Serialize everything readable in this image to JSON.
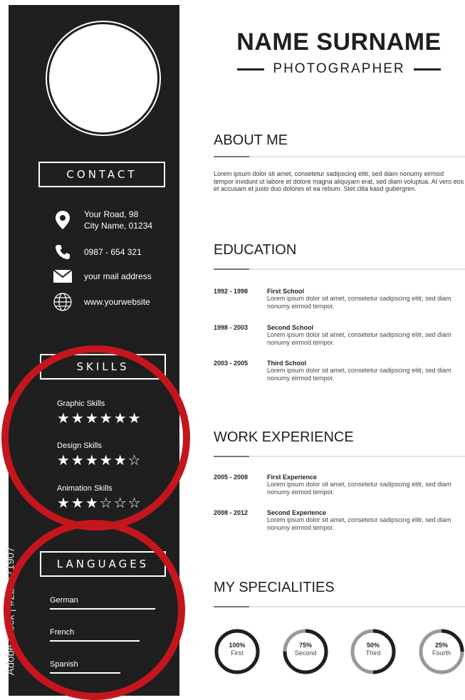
{
  "header": {
    "name": "NAME SURNAME",
    "role": "PHOTOGRAPHER"
  },
  "sidebar": {
    "contact_title": "CONTACT",
    "contact": [
      {
        "icon": "location-pin-icon",
        "line1": "Your Road, 98",
        "line2": "City Name,  01234"
      },
      {
        "icon": "phone-icon",
        "line1": "0987 - 654 321"
      },
      {
        "icon": "mail-icon",
        "line1": "your mail address"
      },
      {
        "icon": "globe-icon",
        "line1": "www.yourwebsite"
      }
    ],
    "skills_title": "SKILLS",
    "skills": [
      {
        "label": "Graphic Skills",
        "rating": 6,
        "max": 6,
        "stars": "★★★★★★"
      },
      {
        "label": "Design Skills",
        "rating": 5,
        "max": 6,
        "stars": "★★★★★☆"
      },
      {
        "label": "Animation Skills",
        "rating": 3,
        "max": 6,
        "stars": "★★★☆☆☆"
      }
    ],
    "languages_title": "LANGUAGES",
    "languages": [
      {
        "label": "German",
        "level": 1.0
      },
      {
        "label": "French",
        "level": 0.85
      },
      {
        "label": "Spanish",
        "level": 0.67
      }
    ],
    "watermark": "Adobe Stock | #220471907"
  },
  "about": {
    "title": "ABOUT ME",
    "text": "Lorem ipsum dolor sit amet, consetetur sadipscing elitr, sed diam nonumy eirmod tempor invidunt ut labore et dolore magna aliquyam erat, sed diam voluptua. At vero eos et accusam et justo duo dolores et ea rebum. Stet clita kasd gubergren."
  },
  "education": {
    "title": "EDUCATION",
    "entries": [
      {
        "years": "1992 - 1998",
        "title": "First School",
        "desc": "Lorem ipsum dolor sit amet, consetetur sadipscing elitr, sed diam nonumy eirmod tempor."
      },
      {
        "years": "1998 - 2003",
        "title": "Second School",
        "desc": "Lorem ipsum dolor sit amet, consetetur sadipscing elitr, sed diam nonumy eirmod tempor."
      },
      {
        "years": "2003 - 2005",
        "title": "Third School",
        "desc": "Lorem ipsum dolor sit amet, consetetur sadipscing elitr, sed diam nonumy eirmod tempor."
      }
    ]
  },
  "work": {
    "title": "WORK EXPERIENCE",
    "entries": [
      {
        "years": "2005 - 2008",
        "title": "First Experience",
        "desc": "Lorem ipsum dolor sit amet, consetetur sadipscing elitr, sed diam nonumy eirmod tempor."
      },
      {
        "years": "2008 - 2012",
        "title": "Second Experience",
        "desc": "Lorem ipsum dolor sit amet, consetetur sadipscing elitr, sed diam nonumy eirmod tempor."
      }
    ]
  },
  "specialities": {
    "title": "MY SPECIALITIES",
    "items": [
      {
        "percent_label": "100%",
        "value": 100,
        "label": "First"
      },
      {
        "percent_label": "75%",
        "value": 75,
        "label": "Second"
      },
      {
        "percent_label": "50%",
        "value": 50,
        "label": "Third"
      },
      {
        "percent_label": "25%",
        "value": 25,
        "label": "Fourth"
      }
    ]
  },
  "colors": {
    "sidebar": "#1f1f1f",
    "highlight": "#c4161c",
    "ring_fill": "#1f1f1f",
    "ring_track": "#999999"
  }
}
